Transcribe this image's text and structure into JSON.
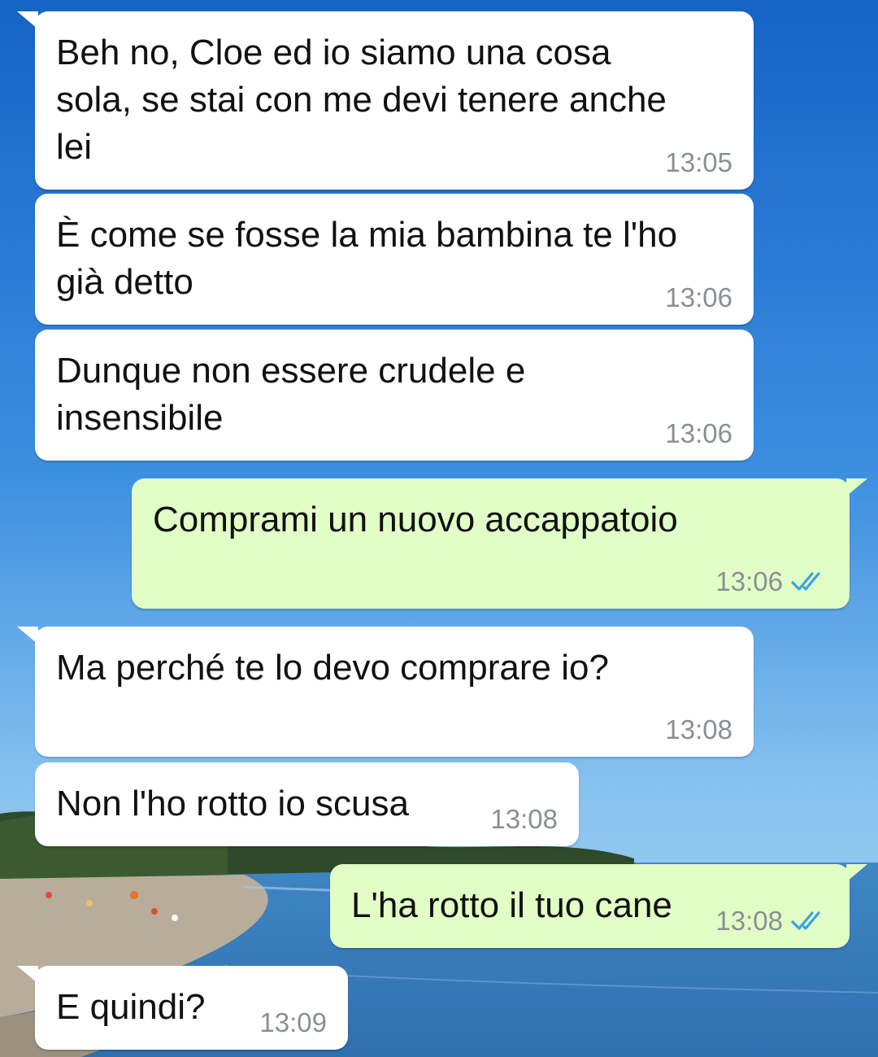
{
  "chat": {
    "messages": [
      {
        "text": "Beh no, Cloe ed io siamo una cosa\nsola, se stai con me devi tenere anche\nlei",
        "time": "13:05"
      },
      {
        "text": "È come se fosse la mia bambina te l'ho\ngià detto",
        "time": "13:06"
      },
      {
        "text": "Dunque non essere crudele e\ninsensibile",
        "time": "13:06"
      },
      {
        "text": "Comprami un nuovo accappatoio",
        "time": "13:06",
        "status": "read-double-check-icon"
      },
      {
        "text": "Ma perché te lo devo comprare io?",
        "time": "13:08"
      },
      {
        "text": "Non l'ho rotto io scusa",
        "time": "13:08"
      },
      {
        "text": "L'ha rotto il tuo cane",
        "time": "13:08",
        "status": "read-double-check-icon"
      },
      {
        "text": "E quindi?",
        "time": "13:09"
      }
    ]
  },
  "colors": {
    "incoming_bubble": "#ffffff",
    "outgoing_bubble": "#e1fec6",
    "timestamp": "#8a8f94",
    "read_ticks": "#3aa3e3",
    "sky_top": "#1665c8",
    "sea": "#3f86c4"
  }
}
